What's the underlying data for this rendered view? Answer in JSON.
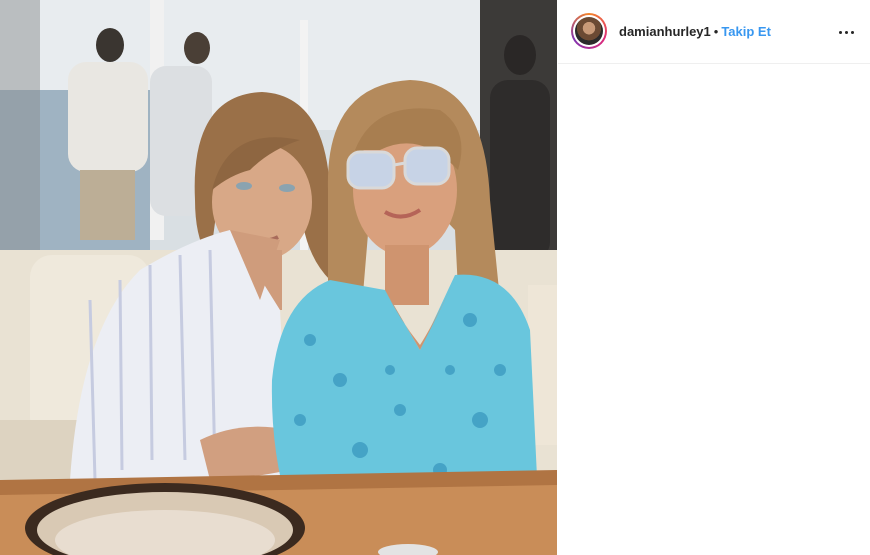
{
  "post": {
    "username": "damianhurley1",
    "separator": "•",
    "follow_label": "Takip Et"
  },
  "icons": {
    "more": "more-options-icon",
    "avatar": "profile-avatar"
  },
  "colors": {
    "follow_link": "#3897f0",
    "username": "#262626",
    "divider": "#efefef"
  }
}
